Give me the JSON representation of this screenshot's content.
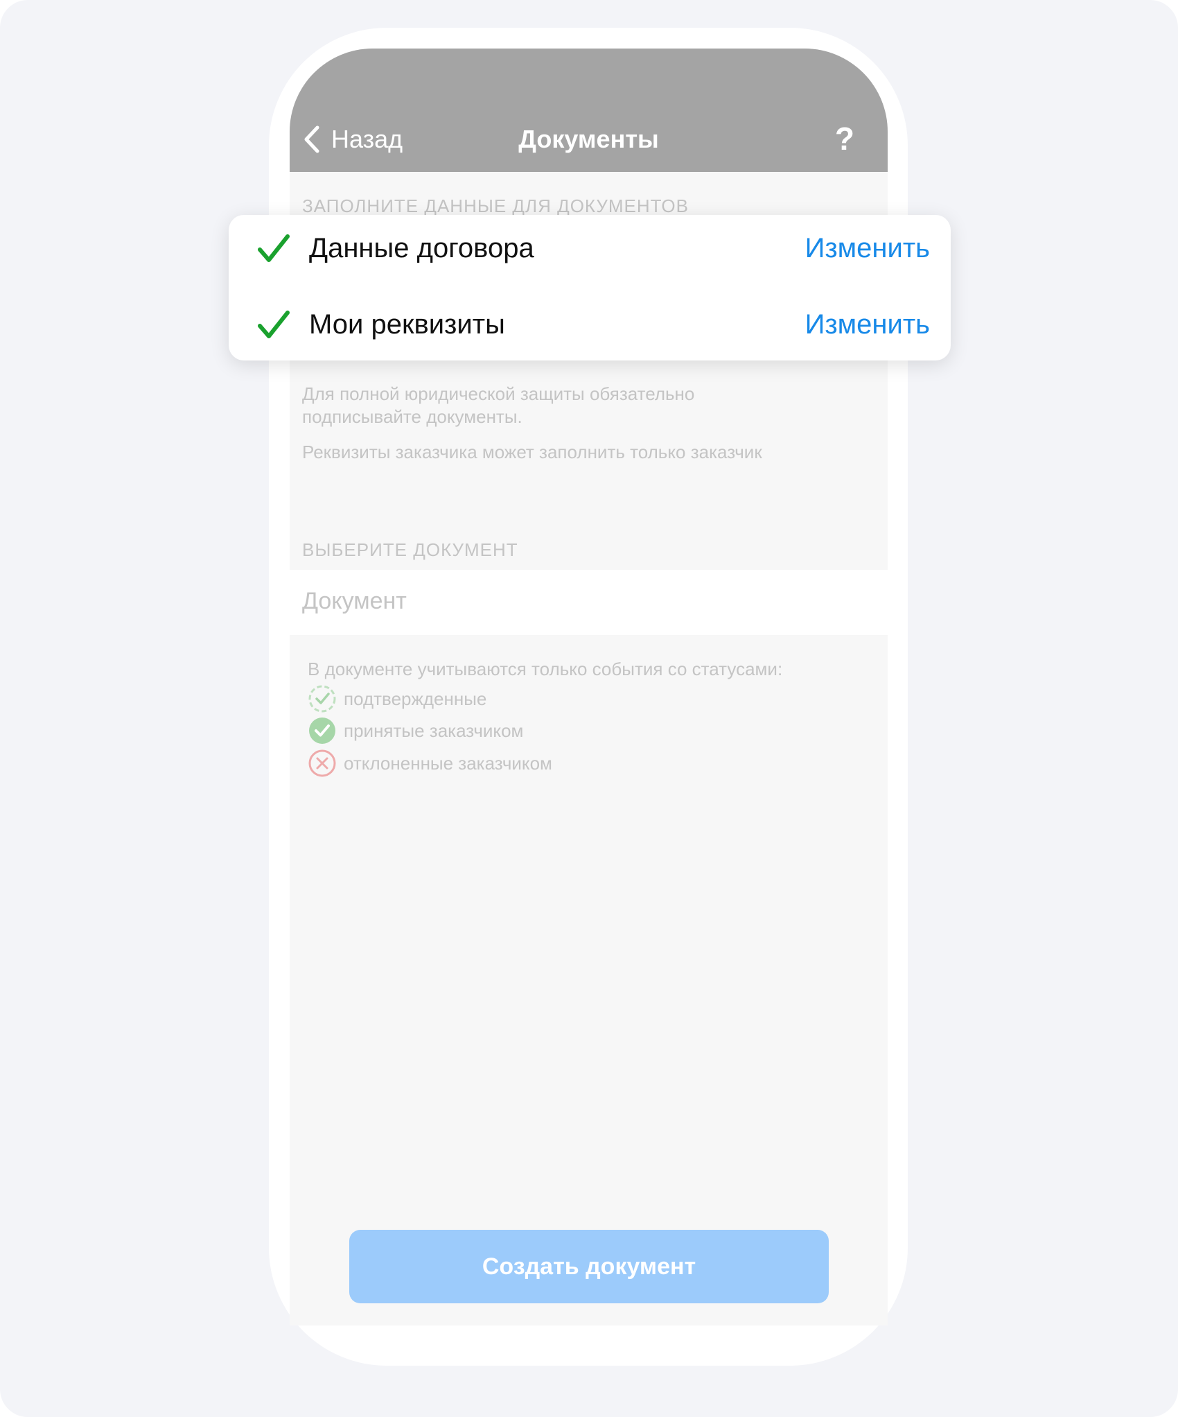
{
  "navbar": {
    "back_label": "Назад",
    "title": "Документы",
    "help_label": "?"
  },
  "form": {
    "fill_section_label": "ЗАПОЛНИТЕ ДАННЫЕ ДЛЯ ДОКУМЕНТОВ",
    "hint_line1": "Для полной юридической защиты обязательно",
    "hint_line2": "подписывайте документы.",
    "hint_customer": "Реквизиты заказчика может заполнить только заказчик",
    "choose_section_label": "ВЫБЕРИТЕ ДОКУМЕНТ",
    "document_placeholder": "Документ"
  },
  "statuses": {
    "heading": "В документе учитываются только события со статусами:",
    "items": [
      {
        "label": "подтвержденные",
        "icon": "dashed-check-circle-icon",
        "color": "#4caf50"
      },
      {
        "label": "принятые заказчиком",
        "icon": "filled-check-circle-icon",
        "color": "#4caf50"
      },
      {
        "label": "отклоненные заказчиком",
        "icon": "x-circle-icon",
        "color": "#e53935"
      }
    ]
  },
  "create_button": {
    "label": "Создать документ"
  },
  "popup": {
    "rows": [
      {
        "label": "Данные договора",
        "action": "Изменить",
        "icon": "checkmark-icon"
      },
      {
        "label": "Мои реквизиты",
        "action": "Изменить",
        "icon": "checkmark-icon"
      }
    ]
  },
  "colors": {
    "accent": "#1789e8",
    "check_green": "#1aa12e",
    "navbar": "#a4a4a4",
    "button_disabled": "#9ccbfb"
  }
}
